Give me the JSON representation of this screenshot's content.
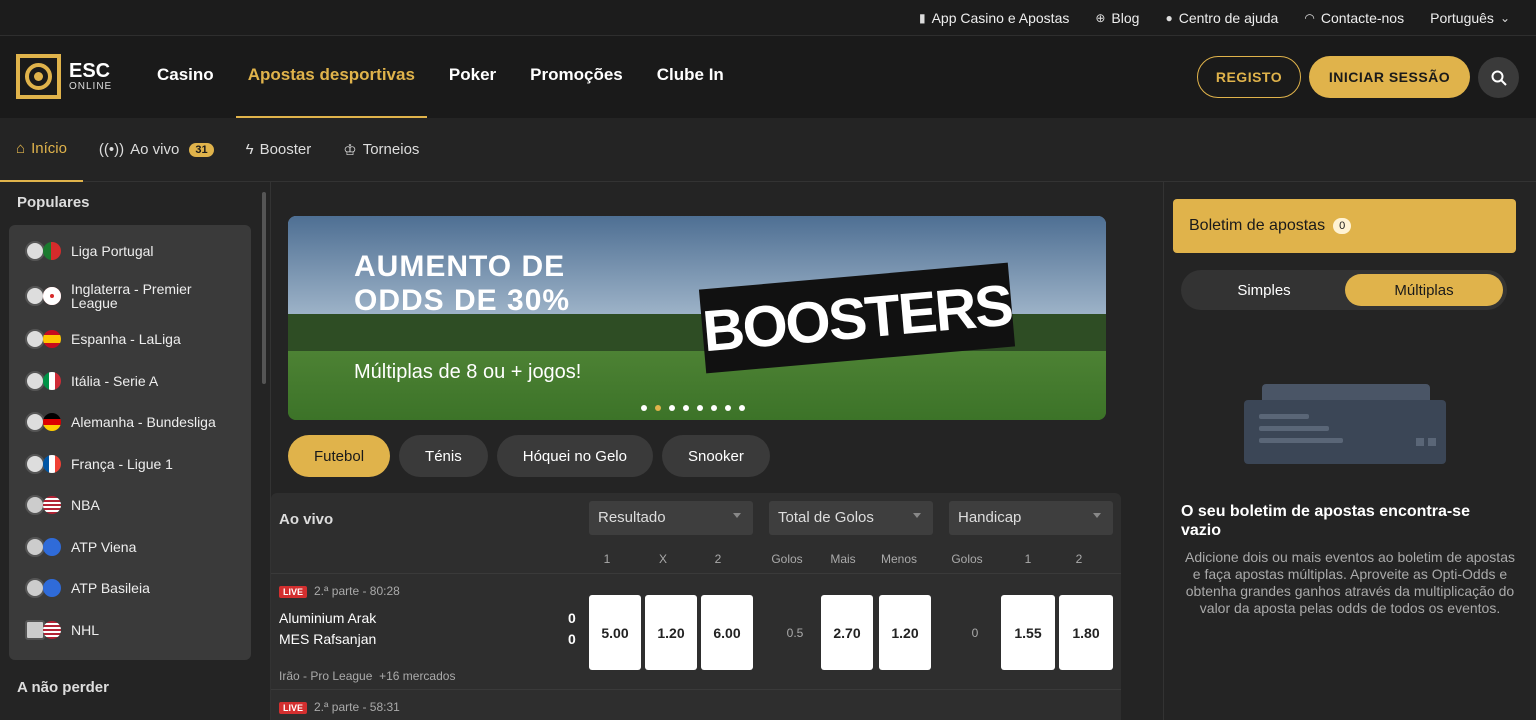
{
  "topbar": {
    "app": "App Casino e Apostas",
    "blog": "Blog",
    "help": "Centro de ajuda",
    "contact": "Contacte-nos",
    "language": "Português"
  },
  "logo": {
    "line1": "ESC",
    "line2": "ONLINE"
  },
  "mainnav": [
    "Casino",
    "Apostas desportivas",
    "Poker",
    "Promoções",
    "Clube In"
  ],
  "auth": {
    "register": "REGISTO",
    "login": "INICIAR SESSÃO"
  },
  "subnav": {
    "home": "Início",
    "live": "Ao vivo",
    "live_count": "31",
    "booster": "Booster",
    "tournaments": "Torneios"
  },
  "sidebar": {
    "popular_title": "Populares",
    "leagues": [
      "Liga Portugal",
      "Inglaterra - Premier League",
      "Espanha - LaLiga",
      "Itália - Serie A",
      "Alemanha - Bundesliga",
      "França - Ligue 1",
      "NBA",
      "ATP Viena",
      "ATP Basileia",
      "NHL"
    ],
    "dont_miss_title": "A não perder"
  },
  "banner": {
    "title_line1": "AUMENTO DE",
    "title_line2": "ODDS DE 30%",
    "subtitle": "Múltiplas de 8 ou + jogos!",
    "badge": "BOOSTERS"
  },
  "sports": [
    "Futebol",
    "Ténis",
    "Hóquei no Gelo",
    "Snooker"
  ],
  "table": {
    "live_label": "Ao vivo",
    "markets": [
      "Resultado",
      "Total de Golos",
      "Handicap"
    ],
    "cols": [
      "1",
      "X",
      "2",
      "Golos",
      "Mais",
      "Menos",
      "Golos",
      "1",
      "2"
    ],
    "match1": {
      "live_tag": "LIVE",
      "time": "2.ª parte - 80:28",
      "home": "Aluminium Arak",
      "away": "MES Rafsanjan",
      "home_score": "0",
      "away_score": "0",
      "odds_1": "5.00",
      "odds_x": "1.20",
      "odds_2": "6.00",
      "total_line": "0.5",
      "over": "2.70",
      "under": "1.20",
      "handicap_line": "0",
      "hcp_1": "1.55",
      "hcp_2": "1.80",
      "league": "Irão - Pro League",
      "markets": "+16 mercados"
    },
    "match2": {
      "live_tag": "LIVE",
      "time": "2.ª parte - 58:31"
    }
  },
  "betslip": {
    "title": "Boletim de apostas",
    "count": "0",
    "simple": "Simples",
    "multiple": "Múltiplas",
    "empty_title": "O seu boletim de apostas encontra-se vazio",
    "empty_text": "Adicione dois ou mais eventos ao boletim de apostas e faça apostas múltiplas. Aproveite as Opti-Odds e obtenha grandes ganhos através da multiplicação do valor da aposta pelas odds de todos os eventos."
  },
  "colors": {
    "accent": "#e0b34b",
    "background": "#242424",
    "live": "#d32f2f"
  }
}
